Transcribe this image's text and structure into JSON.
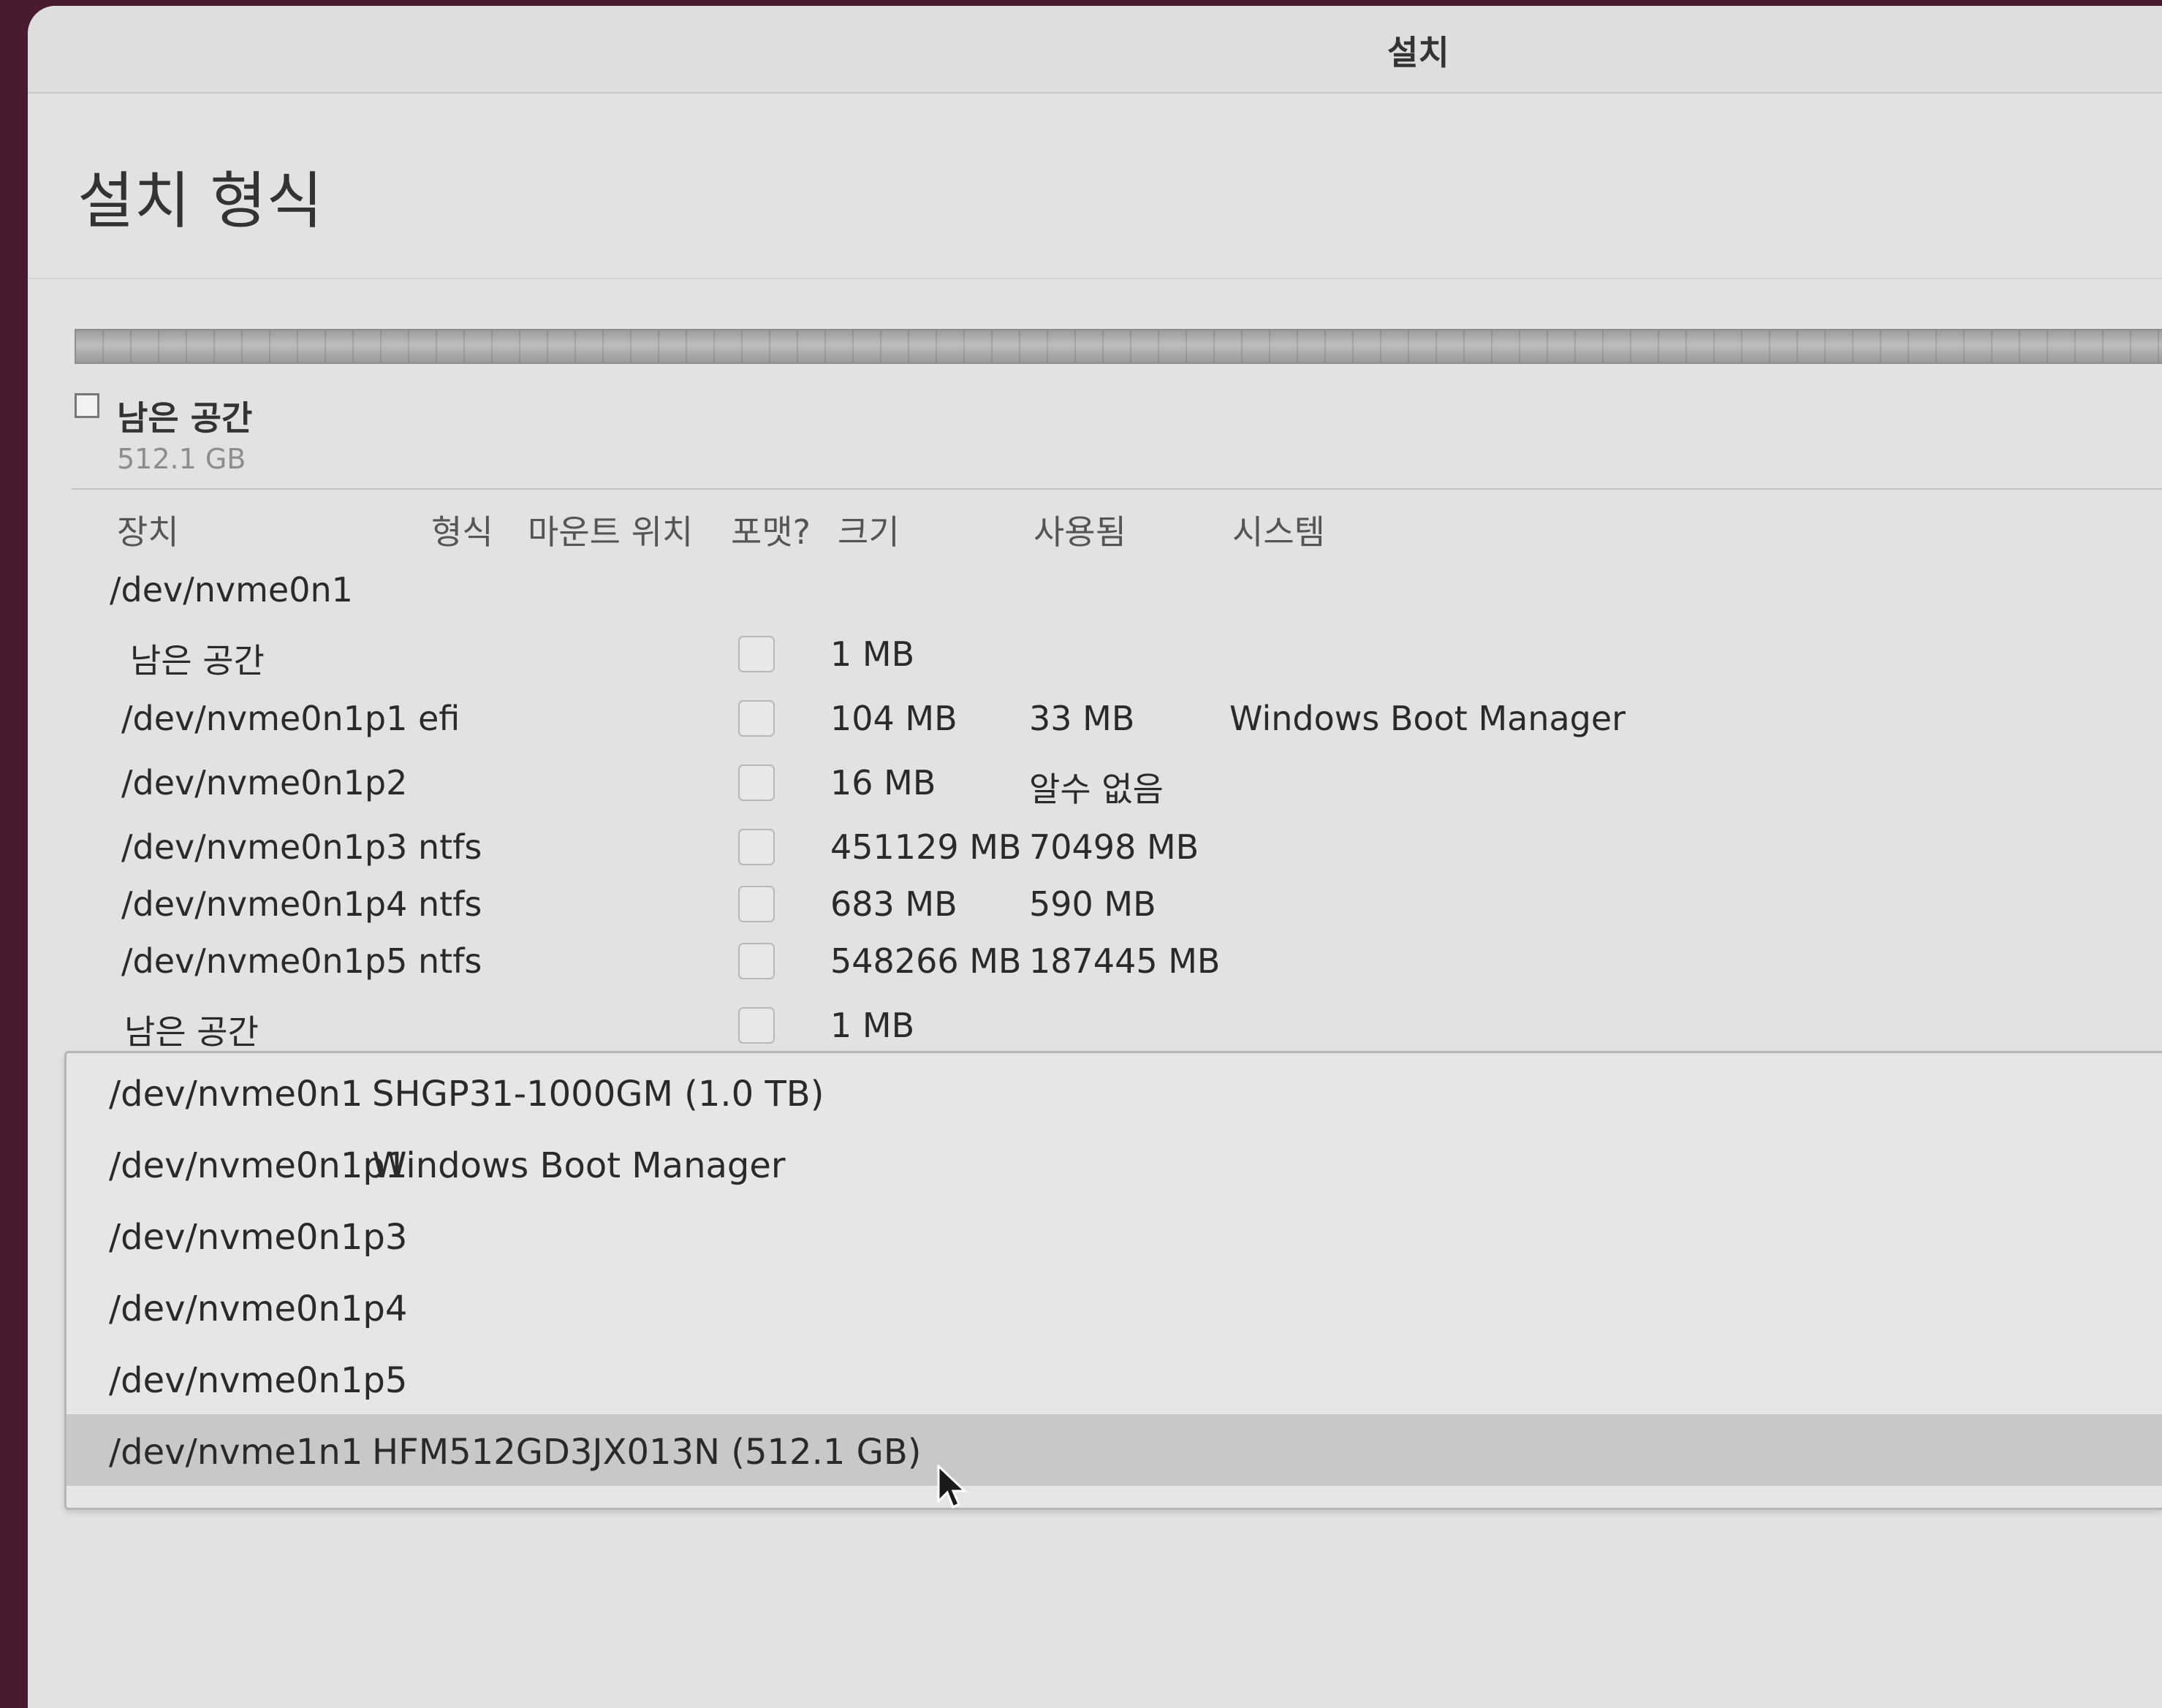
{
  "window": {
    "title": "설치"
  },
  "page": {
    "title": "설치 형식"
  },
  "legend": {
    "label": "남은 공간",
    "size": "512.1 GB"
  },
  "table": {
    "columns": [
      "장치",
      "형식",
      "마운트 위치",
      "포맷?",
      "크기",
      "사용됨",
      "시스템"
    ],
    "disk": "/dev/nvme0n1",
    "rows": [
      {
        "device": "남은 공간",
        "type": "",
        "mount": "",
        "format": false,
        "size": "1 MB",
        "used": "",
        "system": ""
      },
      {
        "device": "/dev/nvme0n1p1",
        "type": "efi",
        "mount": "",
        "format": false,
        "size": "104 MB",
        "used": "33 MB",
        "system": "Windows Boot Manager"
      },
      {
        "device": "/dev/nvme0n1p2",
        "type": "",
        "mount": "",
        "format": false,
        "size": "16 MB",
        "used": "알수 없음",
        "system": ""
      },
      {
        "device": "/dev/nvme0n1p3",
        "type": "ntfs",
        "mount": "",
        "format": false,
        "size": "451129 MB",
        "used": "70498 MB",
        "system": ""
      },
      {
        "device": "/dev/nvme0n1p4",
        "type": "ntfs",
        "mount": "",
        "format": false,
        "size": "683 MB",
        "used": "590 MB",
        "system": ""
      },
      {
        "device": "/dev/nvme0n1p5",
        "type": "ntfs",
        "mount": "",
        "format": false,
        "size": "548266 MB",
        "used": "187445 MB",
        "system": ""
      },
      {
        "device": "남은 공간",
        "type": "",
        "mount": "",
        "format": false,
        "size": "1 MB",
        "used": "",
        "system": ""
      }
    ]
  },
  "bootloader_devices": [
    {
      "device": "/dev/nvme0n1",
      "description": "SHGP31-1000GM (1.0 TB)",
      "selected": false
    },
    {
      "device": "/dev/nvme0n1p1",
      "description": "Windows Boot Manager",
      "selected": false
    },
    {
      "device": "/dev/nvme0n1p3",
      "description": "",
      "selected": false
    },
    {
      "device": "/dev/nvme0n1p4",
      "description": "",
      "selected": false
    },
    {
      "device": "/dev/nvme0n1p5",
      "description": "",
      "selected": false
    },
    {
      "device": "/dev/nvme1n1",
      "description": "HFM512GD3JX013N (512.1 GB)",
      "selected": true
    }
  ],
  "icons": {
    "cursor": "mouse-pointer-icon"
  }
}
